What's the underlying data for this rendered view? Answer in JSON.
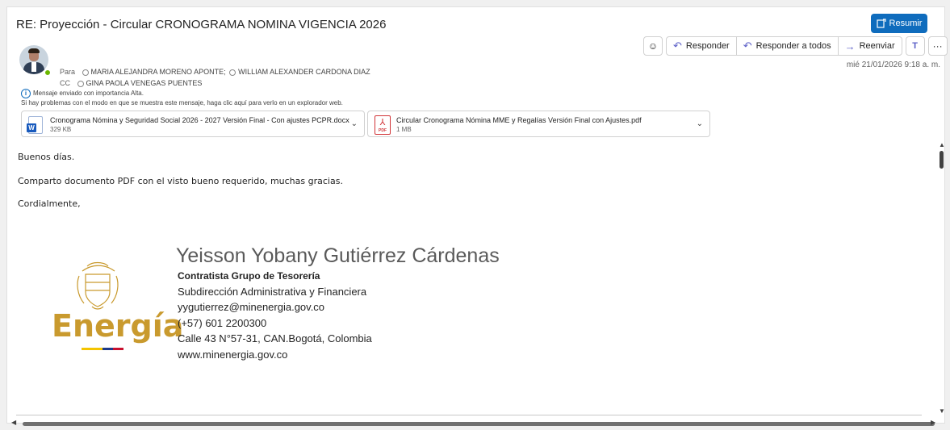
{
  "subject": "RE: Proyección - Circular CRONOGRAMA NOMINA VIGENCIA 2026",
  "summary_button": "Resumir",
  "actions": {
    "emoji_icon": "smiley-icon",
    "reply": "Responder",
    "reply_all": "Responder a todos",
    "forward": "Reenviar",
    "teams_icon": "teams-icon",
    "more": "···"
  },
  "date": "mié 21/01/2026 9:18 a. m.",
  "recipients": {
    "to_label": "Para",
    "to_1": "MARIA ALEJANDRA MORENO APONTE;",
    "to_2": "WILLIAM ALEXANDER CARDONA DIAZ",
    "cc_label": "CC",
    "cc_1": "GINA PAOLA VENEGAS PUENTES"
  },
  "importance": {
    "line1": "Mensaje enviado con importancia Alta.",
    "line2": "Si hay problemas con el modo en que se muestra este mensaje, haga clic aquí para verlo en un explorador web."
  },
  "attachments": [
    {
      "name": "Cronograma Nómina y Seguridad Social 2026 - 2027 Versión Final - Con ajustes PCPR.docx",
      "size": "329 KB",
      "type": "docx"
    },
    {
      "name": "Circular Cronograma Nómina MME y Regalías Versión Final con Ajustes.pdf",
      "size": "1 MB",
      "type": "pdf"
    }
  ],
  "body": {
    "greeting": "Buenos días.",
    "message": "Comparto documento PDF con el visto bueno requerido, muchas gracias.",
    "closing": "Cordialmente,"
  },
  "signature": {
    "logo_text": "Energía",
    "name": "Yeisson Yobany Gutiérrez Cárdenas",
    "role": "Contratista Grupo de Tesorería",
    "department": "Subdirección Administrativa y Financiera",
    "email": "yygutierrez@minenergia.gov.co",
    "phone": "(+57) 601 2200300",
    "address": "Calle 43 N°57-31, CAN.Bogotá, Colombia",
    "website": "www.minenergia.gov.co"
  },
  "colors": {
    "accent": "#0f6cbd",
    "logo_gold": "#c99a2e",
    "presence": "#6bb700"
  }
}
